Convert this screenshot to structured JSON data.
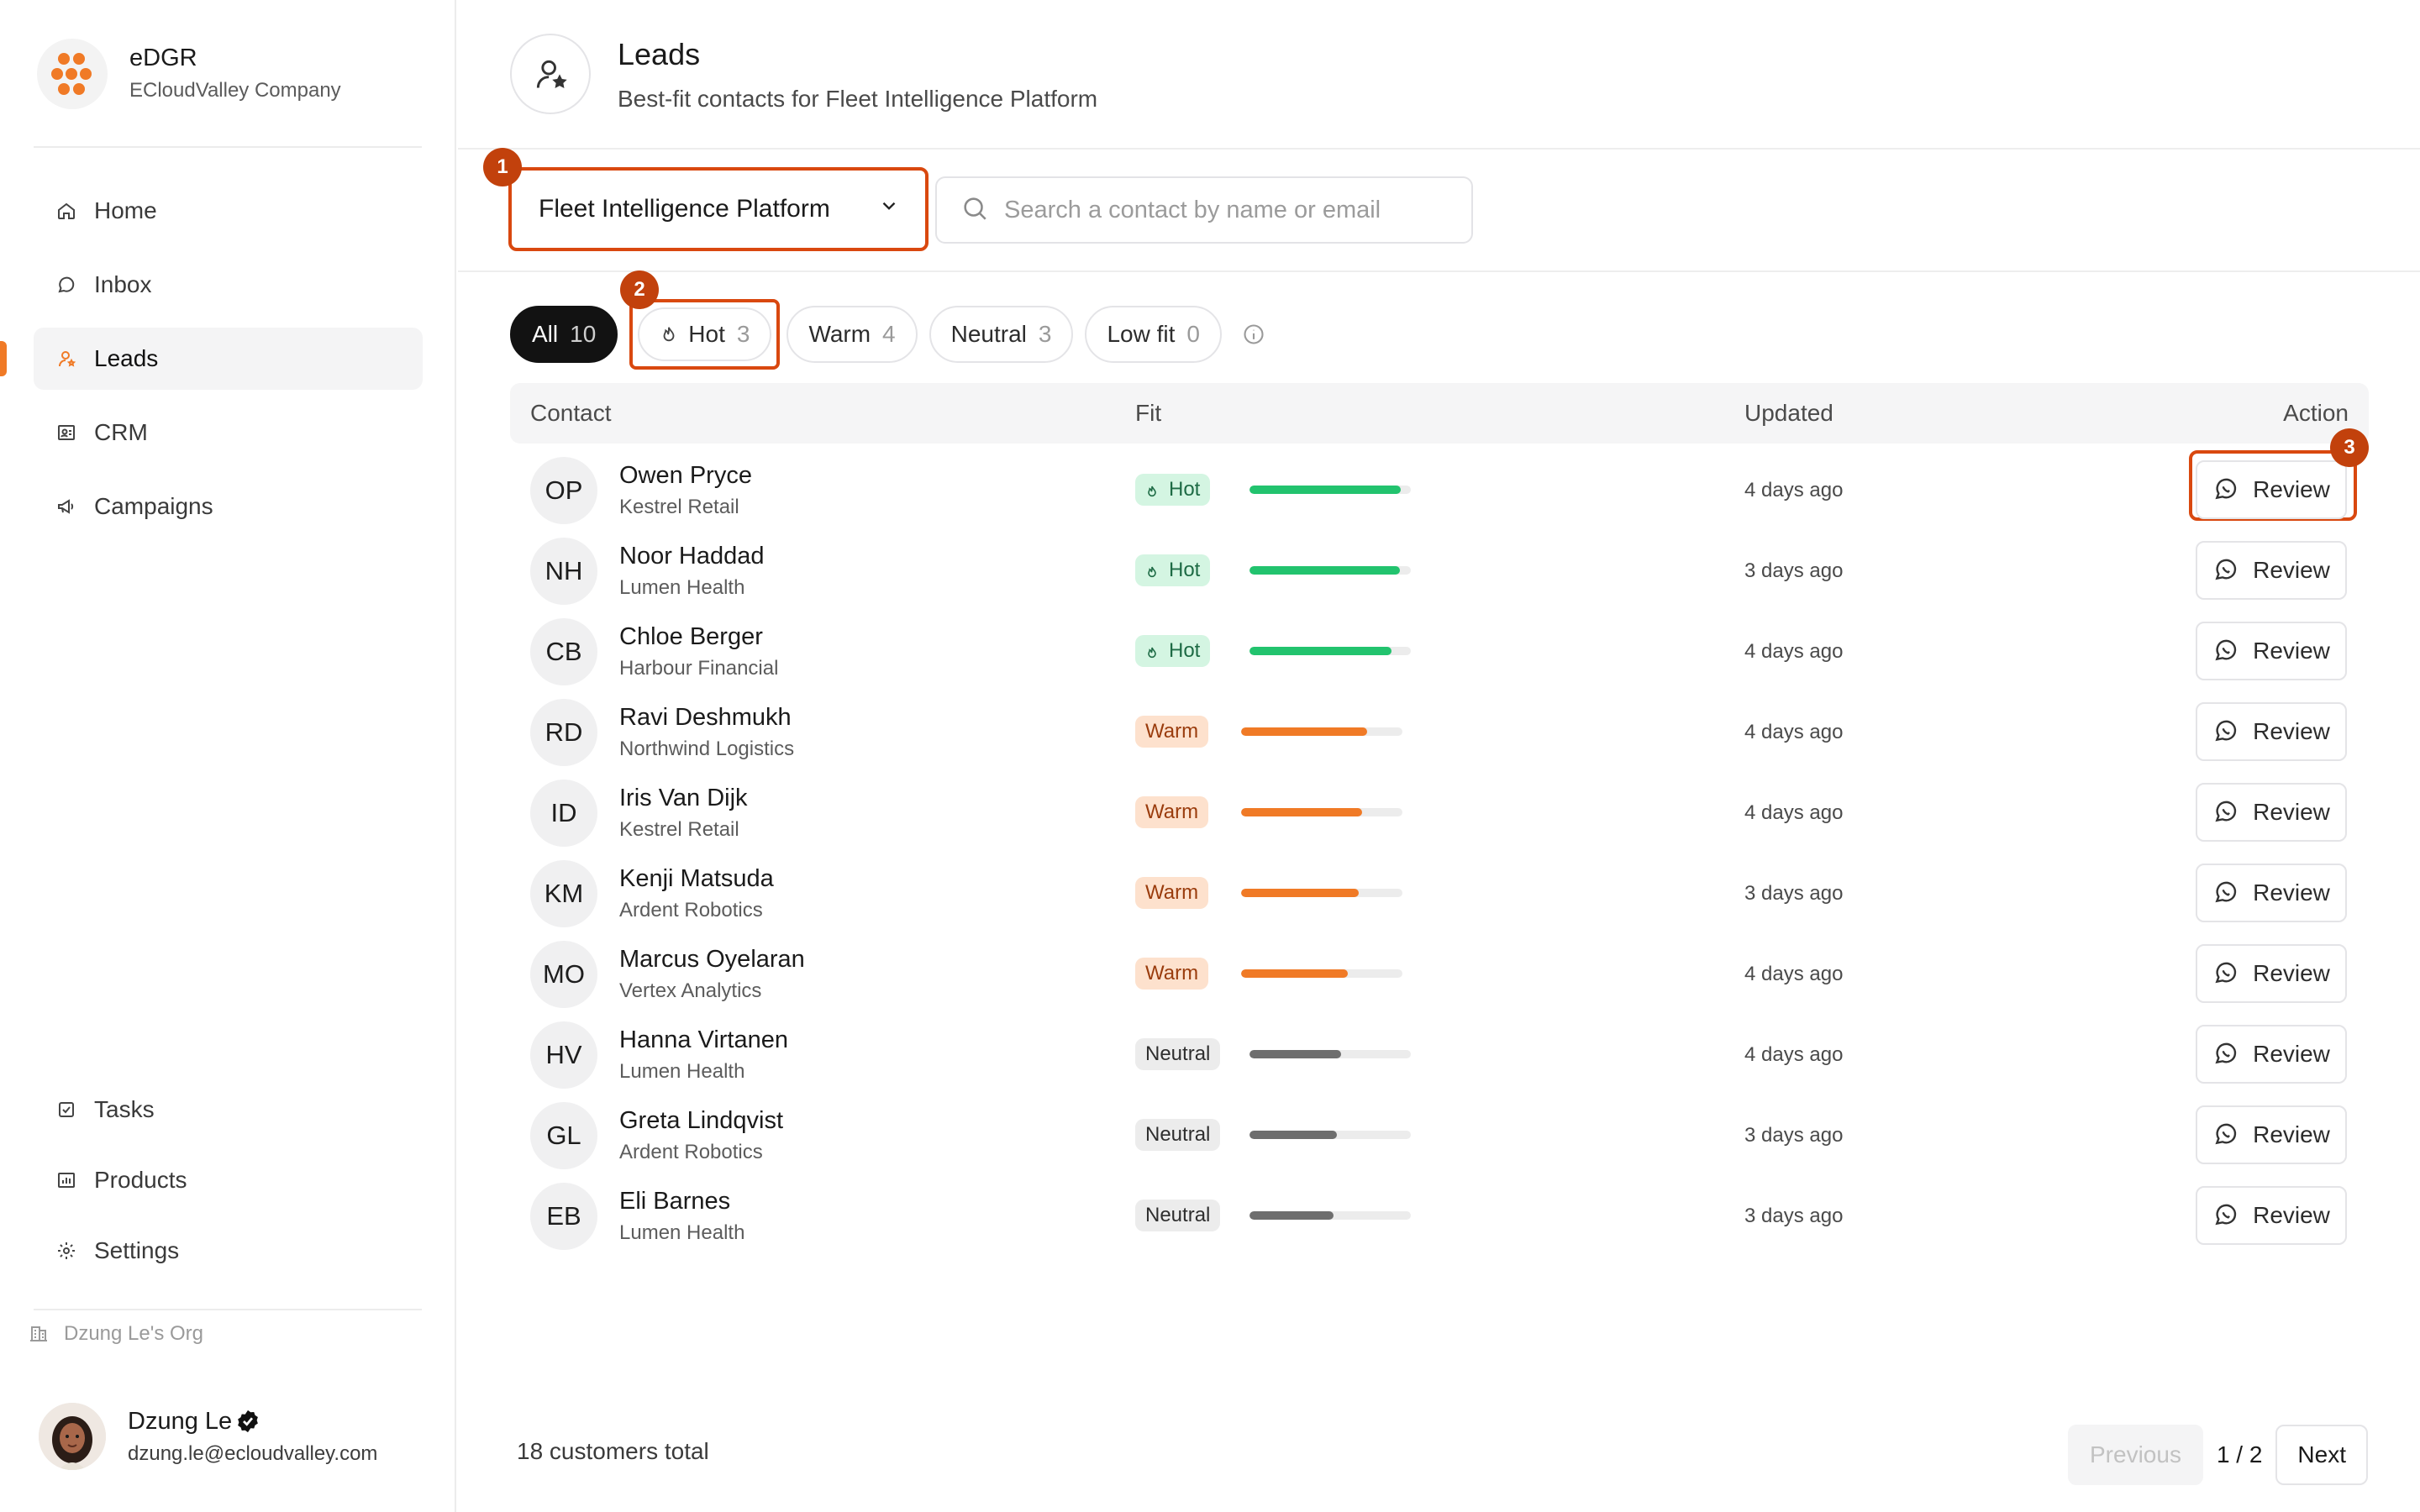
{
  "brand": {
    "name": "eDGR",
    "company": "ECloudValley Company"
  },
  "nav": [
    {
      "label": "Home",
      "icon": "home-icon"
    },
    {
      "label": "Inbox",
      "icon": "chat-bubble-icon"
    },
    {
      "label": "Leads",
      "icon": "user-star-icon",
      "active": true
    },
    {
      "label": "CRM",
      "icon": "contact-card-icon"
    },
    {
      "label": "Campaigns",
      "icon": "megaphone-icon"
    }
  ],
  "nav_bottom": [
    {
      "label": "Tasks",
      "icon": "checkbox-icon"
    },
    {
      "label": "Products",
      "icon": "bar-chart-icon"
    },
    {
      "label": "Settings",
      "icon": "gear-icon"
    }
  ],
  "org": "Dzung Le's Org",
  "user": {
    "name": "Dzung Le",
    "email": "dzung.le@ecloudvalley.com"
  },
  "page": {
    "title": "Leads",
    "subtitle": "Best-fit contacts for Fleet Intelligence Platform"
  },
  "product_select": {
    "value": "Fleet Intelligence Platform"
  },
  "search": {
    "placeholder": "Search a contact by name or email"
  },
  "filters": [
    {
      "label": "All",
      "count": "10",
      "active": true
    },
    {
      "label": "Hot",
      "count": "3"
    },
    {
      "label": "Warm",
      "count": "4"
    },
    {
      "label": "Neutral",
      "count": "3"
    },
    {
      "label": "Low fit",
      "count": "0"
    }
  ],
  "table": {
    "headers": {
      "contact": "Contact",
      "fit": "Fit",
      "updated": "Updated",
      "action": "Action"
    },
    "rows": [
      {
        "initials": "OP",
        "name": "Owen Pryce",
        "company": "Kestrel Retail",
        "fit": "Hot",
        "score": 0.94,
        "updated": "4 days ago",
        "action": "Review"
      },
      {
        "initials": "NH",
        "name": "Noor Haddad",
        "company": "Lumen Health",
        "fit": "Hot",
        "score": 0.93,
        "updated": "3 days ago",
        "action": "Review"
      },
      {
        "initials": "CB",
        "name": "Chloe Berger",
        "company": "Harbour Financial",
        "fit": "Hot",
        "score": 0.88,
        "updated": "4 days ago",
        "action": "Review"
      },
      {
        "initials": "RD",
        "name": "Ravi Deshmukh",
        "company": "Northwind Logistics",
        "fit": "Warm",
        "score": 0.78,
        "updated": "4 days ago",
        "action": "Review"
      },
      {
        "initials": "ID",
        "name": "Iris Van Dijk",
        "company": "Kestrel Retail",
        "fit": "Warm",
        "score": 0.75,
        "updated": "4 days ago",
        "action": "Review"
      },
      {
        "initials": "KM",
        "name": "Kenji Matsuda",
        "company": "Ardent Robotics",
        "fit": "Warm",
        "score": 0.73,
        "updated": "3 days ago",
        "action": "Review"
      },
      {
        "initials": "MO",
        "name": "Marcus Oyelaran",
        "company": "Vertex Analytics",
        "fit": "Warm",
        "score": 0.66,
        "updated": "4 days ago",
        "action": "Review"
      },
      {
        "initials": "HV",
        "name": "Hanna Virtanen",
        "company": "Lumen Health",
        "fit": "Neutral",
        "score": 0.57,
        "updated": "4 days ago",
        "action": "Review"
      },
      {
        "initials": "GL",
        "name": "Greta Lindqvist",
        "company": "Ardent Robotics",
        "fit": "Neutral",
        "score": 0.54,
        "updated": "3 days ago",
        "action": "Review"
      },
      {
        "initials": "EB",
        "name": "Eli Barnes",
        "company": "Lumen Health",
        "fit": "Neutral",
        "score": 0.52,
        "updated": "3 days ago",
        "action": "Review"
      }
    ]
  },
  "footer": {
    "total": "18 customers total",
    "prev": "Previous",
    "page": "1 / 2",
    "next": "Next"
  },
  "callouts": [
    "1",
    "2",
    "3"
  ],
  "colors": {
    "accent": "#f07a26",
    "callout": "#c2410c",
    "hot": "#22c36e",
    "warm": "#f07a26",
    "neutral": "#6e6e6e"
  }
}
